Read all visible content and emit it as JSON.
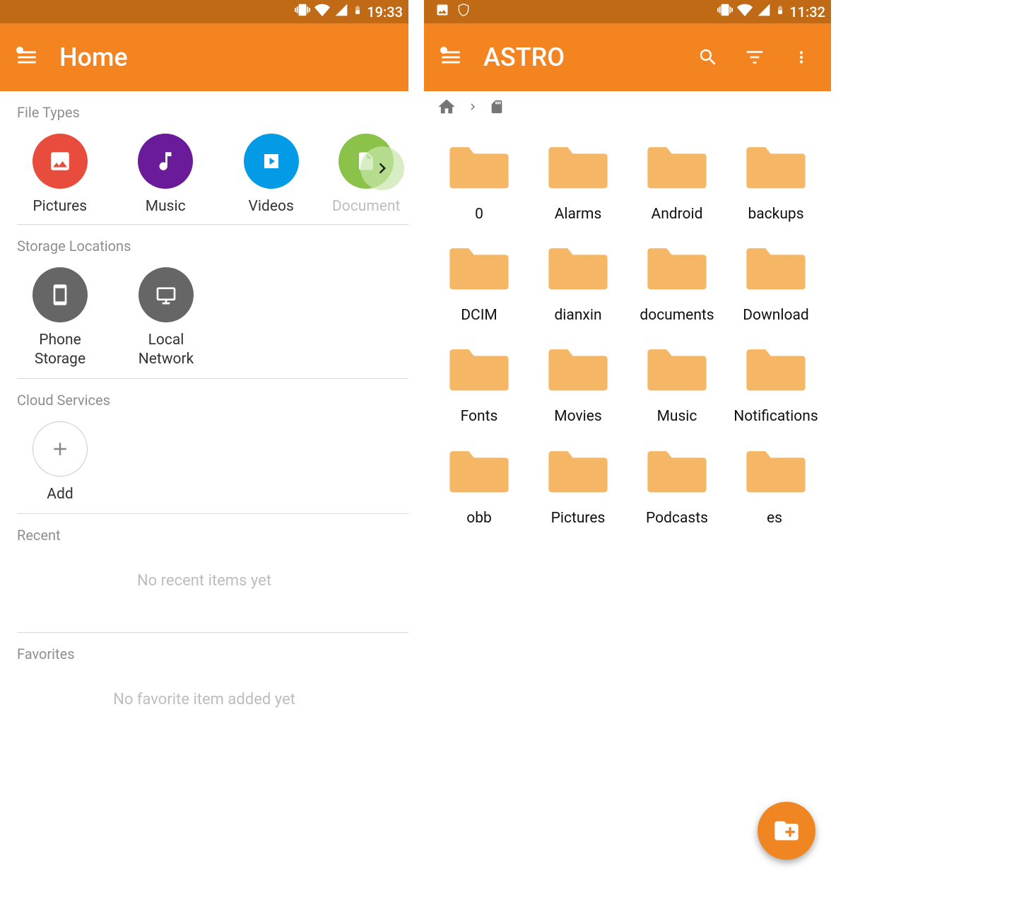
{
  "left": {
    "status": {
      "time": "19:33"
    },
    "appbar": {
      "title": "Home"
    },
    "sections": {
      "file_types": {
        "title": "File Types",
        "items": [
          {
            "label": "Pictures",
            "icon": "picture-icon",
            "color": "c-red"
          },
          {
            "label": "Music",
            "icon": "music-icon",
            "color": "c-purple"
          },
          {
            "label": "Videos",
            "icon": "video-icon",
            "color": "c-blue"
          },
          {
            "label": "Document",
            "icon": "document-icon",
            "color": "c-green"
          }
        ]
      },
      "storage": {
        "title": "Storage Locations",
        "items": [
          {
            "label": "Phone\nStorage",
            "icon": "phone-icon"
          },
          {
            "label": "Local\nNetwork",
            "icon": "network-icon"
          }
        ]
      },
      "cloud": {
        "title": "Cloud Services",
        "add_label": "Add"
      },
      "recent": {
        "title": "Recent",
        "empty": "No recent items yet"
      },
      "favorites": {
        "title": "Favorites",
        "empty": "No favorite item added yet"
      }
    }
  },
  "right": {
    "status": {
      "time": "11:32"
    },
    "appbar": {
      "title": "ASTRO"
    },
    "folders": [
      {
        "label": "0"
      },
      {
        "label": "Alarms"
      },
      {
        "label": "Android"
      },
      {
        "label": "backups"
      },
      {
        "label": "DCIM"
      },
      {
        "label": "dianxin"
      },
      {
        "label": "documents"
      },
      {
        "label": "Download"
      },
      {
        "label": "Fonts"
      },
      {
        "label": "Movies"
      },
      {
        "label": "Music"
      },
      {
        "label": "Notifications"
      },
      {
        "label": "obb"
      },
      {
        "label": "Pictures"
      },
      {
        "label": "Podcasts"
      },
      {
        "label": "es"
      }
    ]
  }
}
